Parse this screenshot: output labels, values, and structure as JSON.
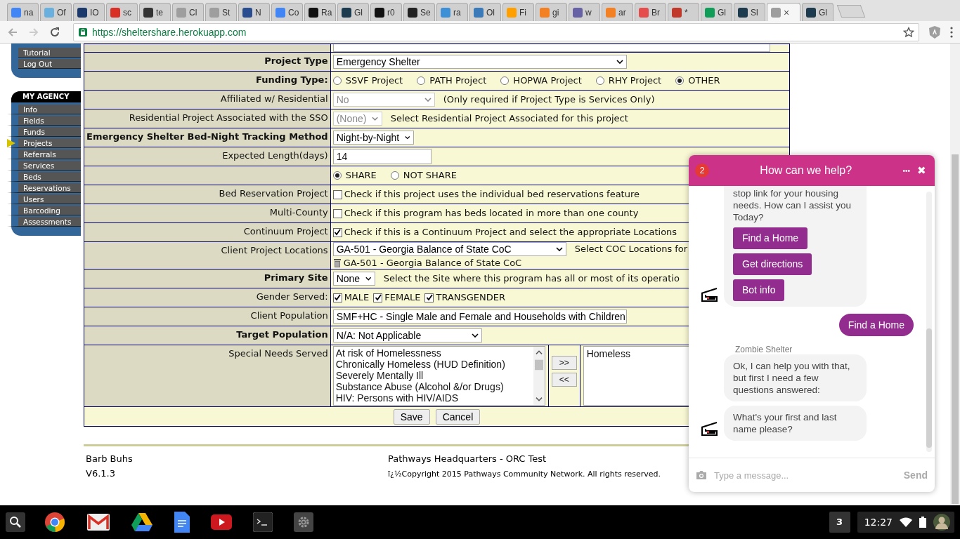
{
  "browser": {
    "tabs": [
      {
        "label": "na",
        "color": "#4285f4",
        "selected": false
      },
      {
        "label": "Of",
        "color": "#6ab0de",
        "selected": false
      },
      {
        "label": "IO",
        "color": "#1b3a6b",
        "selected": false
      },
      {
        "label": "sc",
        "color": "#d93025",
        "selected": false
      },
      {
        "label": "te",
        "color": "#333333",
        "selected": false
      },
      {
        "label": "Cl",
        "color": "#9e9e9e",
        "selected": false
      },
      {
        "label": "St",
        "color": "#9e9e9e",
        "selected": false
      },
      {
        "label": "N",
        "color": "#2a4d8f",
        "selected": false
      },
      {
        "label": "Co",
        "color": "#4285f4",
        "selected": false
      },
      {
        "label": "Ra",
        "color": "#111111",
        "selected": false
      },
      {
        "label": "Gl",
        "color": "#1d3b4f",
        "selected": false
      },
      {
        "label": "r0",
        "color": "#111111",
        "selected": false
      },
      {
        "label": "Se",
        "color": "#222222",
        "selected": false
      },
      {
        "label": "ra",
        "color": "#3d8fd6",
        "selected": false
      },
      {
        "label": "Ol",
        "color": "#3a7ab8",
        "selected": false
      },
      {
        "label": "Fi",
        "color": "#ffa000",
        "selected": false
      },
      {
        "label": "gi",
        "color": "#f48024",
        "selected": false
      },
      {
        "label": "w",
        "color": "#6762a6",
        "selected": false
      },
      {
        "label": "ar",
        "color": "#f48024",
        "selected": false
      },
      {
        "label": "Br",
        "color": "#e54c4c",
        "selected": false
      },
      {
        "label": "*",
        "color": "#c0392b",
        "selected": false
      },
      {
        "label": "Gl",
        "color": "#0f9d58",
        "selected": false
      },
      {
        "label": "Sl",
        "color": "#1d3b4f",
        "selected": false
      },
      {
        "color": "#9e9e9e",
        "selected": true,
        "close": "×"
      },
      {
        "label": "Gl",
        "color": "#1d3b4f",
        "selected": false
      }
    ],
    "url": "https://sheltershare.herokuapp.com"
  },
  "sidebar": {
    "top_links": [
      "Tutorial",
      "Log Out"
    ],
    "section_title": "MY AGENCY",
    "items": [
      {
        "label": "Info",
        "selected": false
      },
      {
        "label": "Fields",
        "selected": false
      },
      {
        "label": "Funds",
        "selected": false
      },
      {
        "label": "Projects",
        "selected": true
      },
      {
        "label": "Referrals",
        "selected": false
      },
      {
        "label": "Services",
        "selected": false
      },
      {
        "label": "Beds",
        "selected": false
      },
      {
        "label": "Reservations",
        "selected": false
      },
      {
        "label": "Users",
        "selected": false
      },
      {
        "label": "Barcoding",
        "selected": false
      },
      {
        "label": "Assessments",
        "selected": false
      }
    ]
  },
  "form": {
    "rows": [
      {
        "kind": "select",
        "label": "Project Type",
        "bold": true,
        "value": "Emergency Shelter",
        "disabled": false
      },
      {
        "kind": "radios",
        "label": "Funding Type:",
        "bold": true,
        "options": [
          {
            "label": "SSVF Project",
            "selected": false
          },
          {
            "label": "PATH Project",
            "selected": false
          },
          {
            "label": "HOPWA Project",
            "selected": false
          },
          {
            "label": "RHY Project",
            "selected": false
          },
          {
            "label": "OTHER",
            "selected": true
          }
        ]
      },
      {
        "kind": "select",
        "label": "Affiliated w/ Residential",
        "bold": false,
        "value": "No",
        "disabled": true,
        "note": "(Only required if Project Type is Services Only)"
      },
      {
        "kind": "select",
        "label": "Residential Project Associated with the SSO",
        "bold": false,
        "value": "(None)",
        "disabled": true,
        "note": "Select Residential Project Associated for this project"
      },
      {
        "kind": "select",
        "label": "Emergency Shelter Bed-Night Tracking Method",
        "bold": true,
        "value": "Night-by-Night",
        "disabled": false
      },
      {
        "kind": "input",
        "label": "Expected Length(days)",
        "bold": false,
        "value": "14"
      },
      {
        "kind": "radios",
        "options": [
          {
            "label": "SHARE",
            "selected": true
          },
          {
            "label": "NOT SHARE",
            "selected": false
          }
        ]
      },
      {
        "kind": "checks",
        "label": "Bed Reservation Project",
        "bold": false,
        "options": [
          {
            "label": "Check if this project uses the individual bed reservations feature",
            "checked": false
          }
        ]
      },
      {
        "kind": "checks",
        "label": "Multi-County",
        "bold": false,
        "options": [
          {
            "label": "Check if this program has beds located in more than one county",
            "checked": false
          }
        ]
      },
      {
        "kind": "checks",
        "label": "Continuum Project",
        "bold": false,
        "options": [
          {
            "label": "Check if this is a Continuum Project and select the appropriate Locations",
            "checked": true
          }
        ]
      },
      {
        "kind": "select",
        "label": "Client Project Locations",
        "bold": false,
        "value": "GA-501 - Georgia Balance of State CoC",
        "disabled": false,
        "note": "Select COC Locations for",
        "chosen": [
          "GA-501 - Georgia Balance of State CoC"
        ]
      },
      {
        "kind": "select",
        "label": "Primary Site",
        "bold": true,
        "value": "None",
        "disabled": false,
        "note": "Select the Site where this program has all or most of its operatio"
      },
      {
        "kind": "checks",
        "label": "Gender Served:",
        "bold": false,
        "options": [
          {
            "label": "MALE",
            "checked": true
          },
          {
            "label": "FEMALE",
            "checked": true
          },
          {
            "label": "TRANSGENDER",
            "checked": true
          }
        ]
      },
      {
        "kind": "select",
        "label": "Client Population",
        "bold": false,
        "value": "SMF+HC - Single Male and Female and Households with Children",
        "disabled": false
      },
      {
        "kind": "select",
        "label": "Target Population",
        "bold": true,
        "value": "N/A: Not Applicable",
        "disabled": false
      },
      {
        "kind": "transfer",
        "label": "Special Needs Served",
        "bold": false,
        "available": [
          "At risk of Homelessness",
          "Chronically Homeless (HUD Definition)",
          "Severely Mentally Ill",
          "Substance Abuse (Alcohol &/or Drugs)",
          "HIV: Persons with HIV/AIDS"
        ],
        "add": ">>",
        "remove": "<<",
        "chosen_list": [
          "Homeless"
        ]
      }
    ],
    "buttons": [
      "Save",
      "Cancel"
    ]
  },
  "footer": {
    "user": "Barb Buhs",
    "agency": "Pathways Headquarters - ORC Test",
    "version": "V6.1.3",
    "copyright": "ï¿½Copyright 2015 Pathways Community Network. All rights reserved."
  },
  "chat": {
    "title": "How can we help?",
    "badge": "2",
    "menu": "•••",
    "close": "✖",
    "messages": [
      {
        "kind": "bot",
        "text": "stop link for your housing needs. How can I assist you Today?",
        "buttons": [
          "Find a Home",
          "Get directions",
          "Bot info"
        ]
      },
      {
        "kind": "user",
        "text": "Find a Home"
      },
      {
        "kind": "sender",
        "text": "Zombie Shelter"
      },
      {
        "kind": "bot",
        "text": "Ok, I can help you with that, but first I need a few questions answered:"
      },
      {
        "kind": "bot",
        "text": "What's your first and last name please?"
      }
    ],
    "placeholder": "Type a message...",
    "send": "Send"
  },
  "taskbar": {
    "badge": "3",
    "time": "12:27"
  }
}
